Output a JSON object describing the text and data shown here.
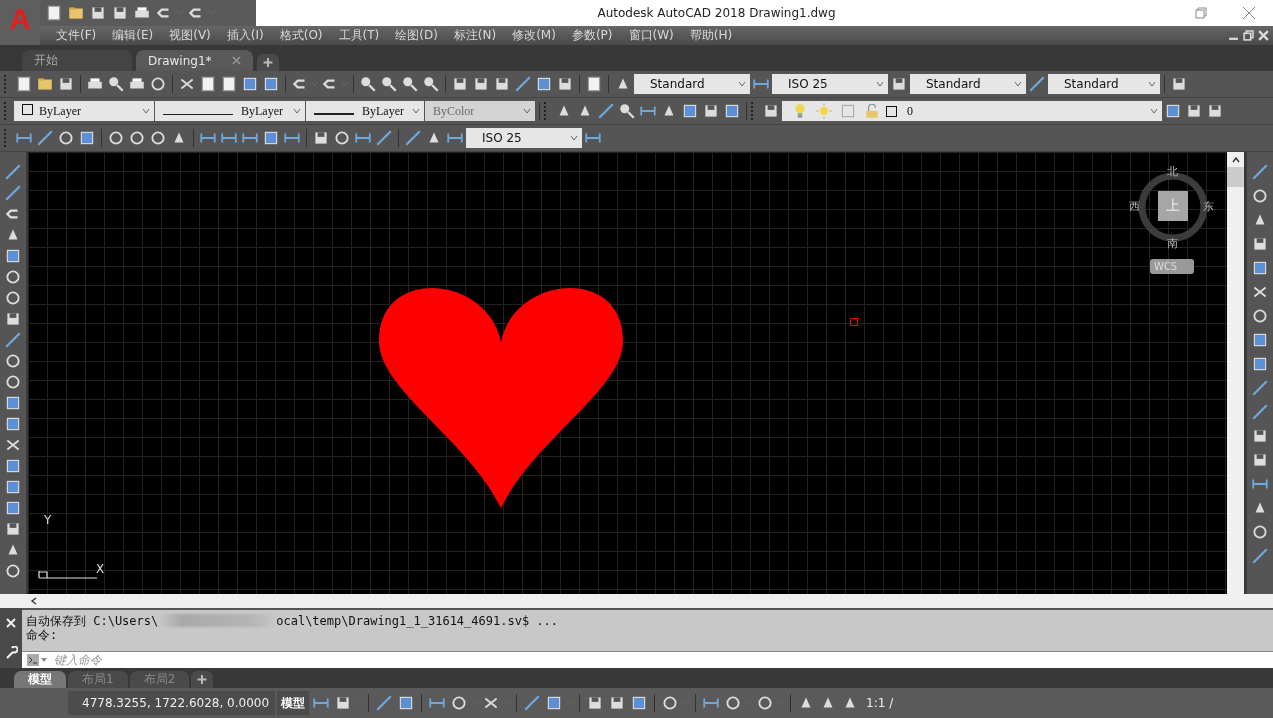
{
  "app_logo": "A",
  "window": {
    "title": "Autodesk AutoCAD 2018    Drawing1.dwg"
  },
  "menu": [
    "文件(F)",
    "编辑(E)",
    "视图(V)",
    "插入(I)",
    "格式(O)",
    "工具(T)",
    "绘图(D)",
    "标注(N)",
    "修改(M)",
    "参数(P)",
    "窗口(W)",
    "帮助(H)"
  ],
  "doc_tabs": [
    {
      "label": "开始",
      "selected": false
    },
    {
      "label": "Drawing1*",
      "selected": true
    }
  ],
  "styles_toolbar": {
    "text_style": "Standard",
    "dim_style": "ISO 25",
    "table_style": "Standard",
    "multileader_style": "Standard"
  },
  "properties_toolbar": {
    "color_setting": "ByLayer",
    "linetype": "ByLayer",
    "lineweight": "ByLayer",
    "plot_style": {
      "value": "ByColor",
      "disabled": true
    }
  },
  "layers_toolbar": {
    "layer": "0"
  },
  "dimension_toolbar": {
    "dim_style": "ISO 25"
  },
  "compass": {
    "north": "北",
    "east": "东",
    "south": "南",
    "west": "西",
    "cube": "上",
    "ucs": "WCS"
  },
  "ucs_icon": {
    "y_label": "Y",
    "x_label": "X"
  },
  "command": {
    "history": [
      {
        "text": "自动保存到 C:\\Users\\",
        "text_after": "ocal\\temp\\Drawing1_1_31614_4691.sv$ ..."
      },
      {
        "text": "命令:"
      }
    ],
    "placeholder": "键入命令"
  },
  "layout_tabs": [
    {
      "label": "模型",
      "selected": true
    },
    {
      "label": "布局1",
      "selected": false
    },
    {
      "label": "布局2",
      "selected": false
    }
  ],
  "status_bar": {
    "coordinates": "4778.3255, 1722.6028, 0.0000",
    "space": "模型",
    "scale": "1:1 /"
  }
}
